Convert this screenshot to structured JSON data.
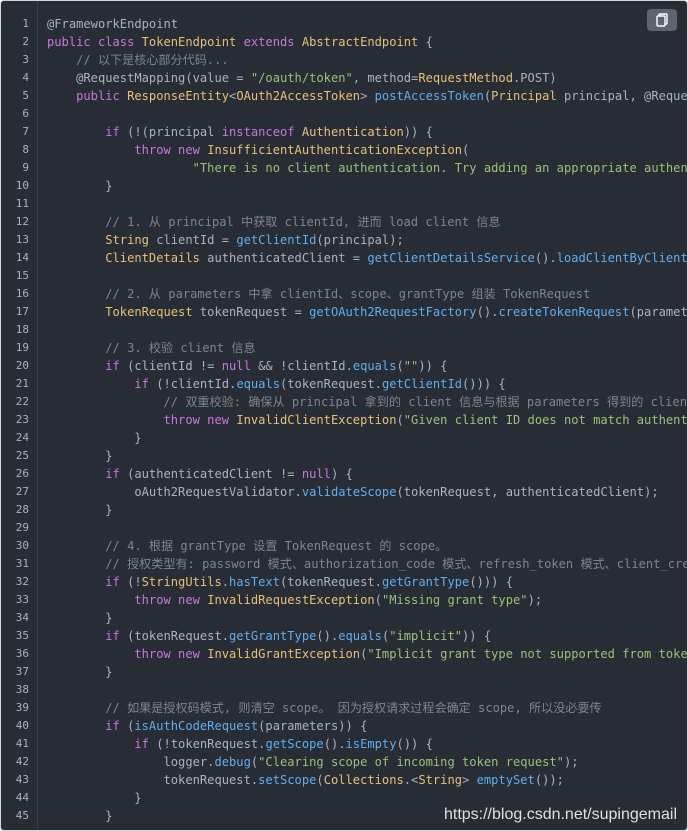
{
  "copy_button": {
    "icon": "copy-icon"
  },
  "watermark": "https://blog.csdn.net/supingemail",
  "code_lines": [
    [
      [
        "an",
        "@FrameworkEndpoint"
      ]
    ],
    [
      [
        "kw",
        "public class "
      ],
      [
        "ty",
        "TokenEndpoint"
      ],
      [
        "kw",
        " extends "
      ],
      [
        "ty",
        "AbstractEndpoint"
      ],
      [
        "an",
        " {"
      ]
    ],
    [
      [
        "cm",
        "    // 以下是核心部分代码..."
      ]
    ],
    [
      [
        "an",
        "    @RequestMapping(value = "
      ],
      [
        "st",
        "\"/oauth/token\""
      ],
      [
        "an",
        ", method="
      ],
      [
        "ty",
        "RequestMethod"
      ],
      [
        "an",
        ".POST)"
      ]
    ],
    [
      [
        "kw",
        "    public "
      ],
      [
        "ty",
        "ResponseEntity"
      ],
      [
        "an",
        "<"
      ],
      [
        "ty",
        "OAuth2AccessToken"
      ],
      [
        "an",
        "> "
      ],
      [
        "fn",
        "postAccessToken"
      ],
      [
        "an",
        "("
      ],
      [
        "ty",
        "Principal"
      ],
      [
        "an",
        " principal, @RequestParam M"
      ]
    ],
    [
      [
        "an",
        ""
      ]
    ],
    [
      [
        "kw",
        "        if "
      ],
      [
        "an",
        "(!(principal "
      ],
      [
        "kw",
        "instanceof "
      ],
      [
        "ty",
        "Authentication"
      ],
      [
        "an",
        ")) {"
      ]
    ],
    [
      [
        "kw",
        "            throw new "
      ],
      [
        "ty",
        "InsufficientAuthenticationException"
      ],
      [
        "an",
        "("
      ]
    ],
    [
      [
        "st",
        "                    \"There is no client authentication. Try adding an appropriate authentication"
      ]
    ],
    [
      [
        "an",
        "        }"
      ]
    ],
    [
      [
        "an",
        ""
      ]
    ],
    [
      [
        "cm",
        "        // 1. 从 principal 中获取 clientId, 进而 load client 信息"
      ]
    ],
    [
      [
        "ty",
        "        String"
      ],
      [
        "an",
        " clientId = "
      ],
      [
        "fn",
        "getClientId"
      ],
      [
        "an",
        "(principal);"
      ]
    ],
    [
      [
        "ty",
        "        ClientDetails"
      ],
      [
        "an",
        " authenticatedClient = "
      ],
      [
        "fn",
        "getClientDetailsService"
      ],
      [
        "an",
        "()."
      ],
      [
        "fn",
        "loadClientByClientId"
      ],
      [
        "an",
        "(client"
      ]
    ],
    [
      [
        "an",
        ""
      ]
    ],
    [
      [
        "cm",
        "        // 2. 从 parameters 中拿 clientId、scope、grantType 组装 TokenRequest"
      ]
    ],
    [
      [
        "ty",
        "        TokenRequest"
      ],
      [
        "an",
        " tokenRequest = "
      ],
      [
        "fn",
        "getOAuth2RequestFactory"
      ],
      [
        "an",
        "()."
      ],
      [
        "fn",
        "createTokenRequest"
      ],
      [
        "an",
        "(parameters, auth"
      ]
    ],
    [
      [
        "an",
        ""
      ]
    ],
    [
      [
        "cm",
        "        // 3. 校验 client 信息"
      ]
    ],
    [
      [
        "kw",
        "        if "
      ],
      [
        "an",
        "(clientId != "
      ],
      [
        "kw",
        "null"
      ],
      [
        "an",
        " && !clientId."
      ],
      [
        "fn",
        "equals"
      ],
      [
        "an",
        "("
      ],
      [
        "st",
        "\"\""
      ],
      [
        "an",
        ")) {"
      ]
    ],
    [
      [
        "kw",
        "            if "
      ],
      [
        "an",
        "(!clientId."
      ],
      [
        "fn",
        "equals"
      ],
      [
        "an",
        "(tokenRequest."
      ],
      [
        "fn",
        "getClientId"
      ],
      [
        "an",
        "())) {"
      ]
    ],
    [
      [
        "cm",
        "                // 双重校验: 确保从 principal 拿到的 client 信息与根据 parameters 得到的 client 信息"
      ]
    ],
    [
      [
        "kw",
        "                throw new "
      ],
      [
        "ty",
        "InvalidClientException"
      ],
      [
        "an",
        "("
      ],
      [
        "st",
        "\"Given client ID does not match authenticated cl"
      ]
    ],
    [
      [
        "an",
        "            }"
      ]
    ],
    [
      [
        "an",
        "        }"
      ]
    ],
    [
      [
        "kw",
        "        if "
      ],
      [
        "an",
        "(authenticatedClient != "
      ],
      [
        "kw",
        "null"
      ],
      [
        "an",
        ") {"
      ]
    ],
    [
      [
        "an",
        "            oAuth2RequestValidator."
      ],
      [
        "fn",
        "validateScope"
      ],
      [
        "an",
        "(tokenRequest, authenticatedClient);"
      ]
    ],
    [
      [
        "an",
        "        }"
      ]
    ],
    [
      [
        "an",
        ""
      ]
    ],
    [
      [
        "cm",
        "        // 4. 根据 grantType 设置 TokenRequest 的 scope。"
      ]
    ],
    [
      [
        "cm",
        "        // 授权类型有: password 模式、authorization_code 模式、refresh_token 模式、client_credentia"
      ]
    ],
    [
      [
        "kw",
        "        if "
      ],
      [
        "an",
        "(!"
      ],
      [
        "ty",
        "StringUtils"
      ],
      [
        "an",
        "."
      ],
      [
        "fn",
        "hasText"
      ],
      [
        "an",
        "(tokenRequest."
      ],
      [
        "fn",
        "getGrantType"
      ],
      [
        "an",
        "())) {"
      ]
    ],
    [
      [
        "kw",
        "            throw new "
      ],
      [
        "ty",
        "InvalidRequestException"
      ],
      [
        "an",
        "("
      ],
      [
        "st",
        "\"Missing grant type\""
      ],
      [
        "an",
        ");"
      ]
    ],
    [
      [
        "an",
        "        }"
      ]
    ],
    [
      [
        "kw",
        "        if "
      ],
      [
        "an",
        "(tokenRequest."
      ],
      [
        "fn",
        "getGrantType"
      ],
      [
        "an",
        "()."
      ],
      [
        "fn",
        "equals"
      ],
      [
        "an",
        "("
      ],
      [
        "st",
        "\"implicit\""
      ],
      [
        "an",
        ")) {"
      ]
    ],
    [
      [
        "kw",
        "            throw new "
      ],
      [
        "ty",
        "InvalidGrantException"
      ],
      [
        "an",
        "("
      ],
      [
        "st",
        "\"Implicit grant type not supported from token endpoin"
      ]
    ],
    [
      [
        "an",
        "        }"
      ]
    ],
    [
      [
        "an",
        ""
      ]
    ],
    [
      [
        "cm",
        "        // 如果是授权码模式, 则清空 scope。 因为授权请求过程会确定 scope, 所以没必要传"
      ]
    ],
    [
      [
        "kw",
        "        if "
      ],
      [
        "an",
        "("
      ],
      [
        "fn",
        "isAuthCodeRequest"
      ],
      [
        "an",
        "(parameters)) {"
      ]
    ],
    [
      [
        "kw",
        "            if "
      ],
      [
        "an",
        "(!tokenRequest."
      ],
      [
        "fn",
        "getScope"
      ],
      [
        "an",
        "()."
      ],
      [
        "fn",
        "isEmpty"
      ],
      [
        "an",
        "()) {"
      ]
    ],
    [
      [
        "an",
        "                logger."
      ],
      [
        "fn",
        "debug"
      ],
      [
        "an",
        "("
      ],
      [
        "st",
        "\"Clearing scope of incoming token request\""
      ],
      [
        "an",
        ");"
      ]
    ],
    [
      [
        "an",
        "                tokenRequest."
      ],
      [
        "fn",
        "setScope"
      ],
      [
        "an",
        "("
      ],
      [
        "ty",
        "Collections"
      ],
      [
        "an",
        ".<"
      ],
      [
        "ty",
        "String"
      ],
      [
        "an",
        "> "
      ],
      [
        "fn",
        "emptySet"
      ],
      [
        "an",
        "());"
      ]
    ],
    [
      [
        "an",
        "            }"
      ]
    ],
    [
      [
        "an",
        "        }"
      ]
    ]
  ]
}
